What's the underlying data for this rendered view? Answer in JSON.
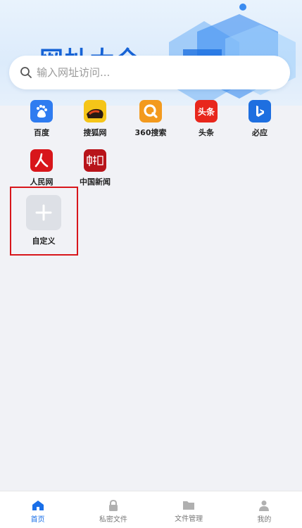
{
  "banner": {
    "title": "网址大全"
  },
  "search": {
    "placeholder": "输入网址访问..."
  },
  "shortcuts": [
    {
      "label": "百度",
      "icon": "baidu-icon",
      "color": "#2f7cf0"
    },
    {
      "label": "搜狐网",
      "icon": "sohu-icon",
      "color": "#f5c518"
    },
    {
      "label": "360搜索",
      "icon": "360-search-icon",
      "color": "#f39a1e"
    },
    {
      "label": "头条",
      "icon": "toutiao-icon",
      "color": "#e8271c"
    },
    {
      "label": "必应",
      "icon": "bing-icon",
      "color": "#1e6fe0"
    },
    {
      "label": "人民网",
      "icon": "people-daily-icon",
      "color": "#d8161b"
    },
    {
      "label": "中国新闻",
      "icon": "chinanews-icon",
      "color": "#b8141a"
    }
  ],
  "shortcut_icon_text": {
    "toutiao": "头条"
  },
  "custom": {
    "label": "自定义"
  },
  "nav": [
    {
      "label": "首页",
      "active": true
    },
    {
      "label": "私密文件",
      "active": false
    },
    {
      "label": "文件管理",
      "active": false
    },
    {
      "label": "我的",
      "active": false
    }
  ],
  "colors": {
    "accent": "#1a6fe8",
    "highlight_frame": "#d8161b"
  }
}
